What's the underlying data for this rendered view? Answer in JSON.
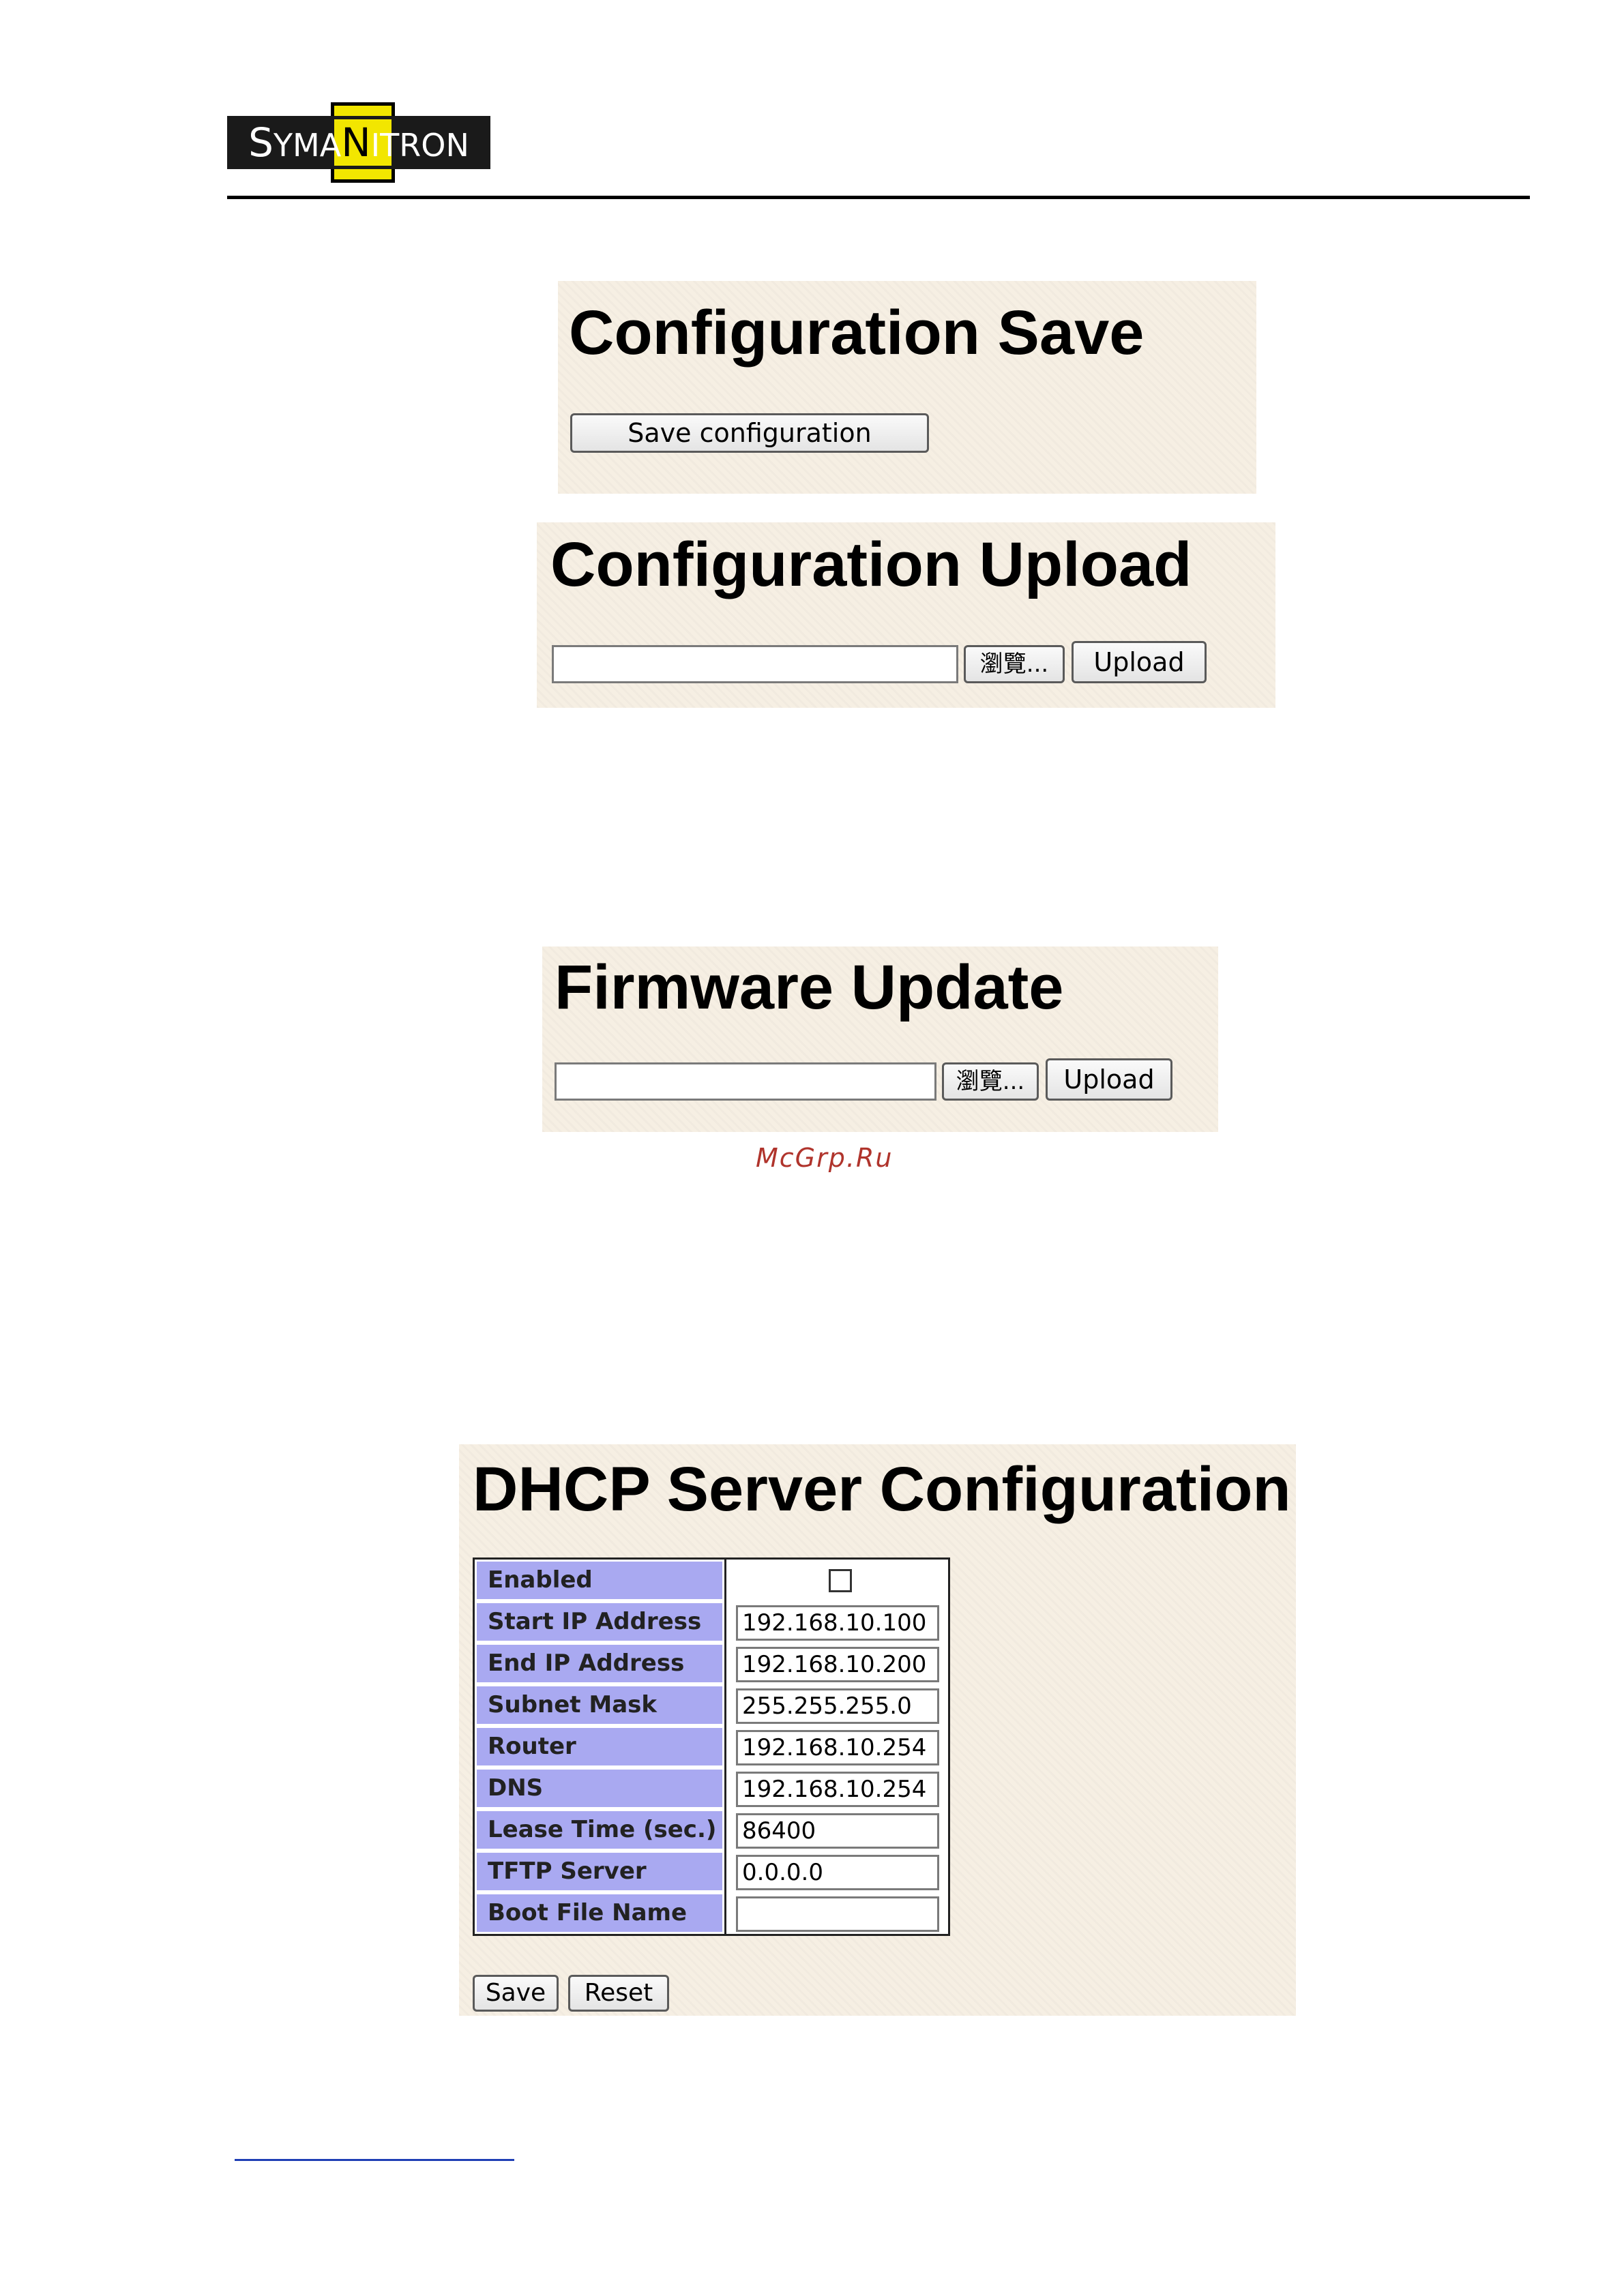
{
  "header": {
    "logo_text_part1": "S",
    "logo_text_part2": "YMA",
    "logo_text_part3": "N",
    "logo_text_part4": "ITRON"
  },
  "config_save": {
    "title": "Configuration Save",
    "button_label": "Save configuration"
  },
  "config_upload": {
    "title": "Configuration Upload",
    "file_value": "",
    "browse_label": "瀏覽...",
    "upload_label": "Upload"
  },
  "firmware_update": {
    "title": "Firmware Update",
    "file_value": "",
    "browse_label": "瀏覽...",
    "upload_label": "Upload"
  },
  "watermark": "McGrp.Ru",
  "dhcp": {
    "title": "DHCP Server Configuration",
    "enabled": false,
    "rows": [
      {
        "label": "Enabled",
        "value": ""
      },
      {
        "label": "Start IP Address",
        "value": "192.168.10.100"
      },
      {
        "label": "End IP Address",
        "value": "192.168.10.200"
      },
      {
        "label": "Subnet Mask",
        "value": "255.255.255.0"
      },
      {
        "label": "Router",
        "value": "192.168.10.254"
      },
      {
        "label": "DNS",
        "value": "192.168.10.254"
      },
      {
        "label": "Lease Time (sec.)",
        "value": "86400"
      },
      {
        "label": "TFTP Server",
        "value": "0.0.0.0"
      },
      {
        "label": "Boot File Name",
        "value": ""
      }
    ],
    "save_label": "Save",
    "reset_label": "Reset"
  }
}
